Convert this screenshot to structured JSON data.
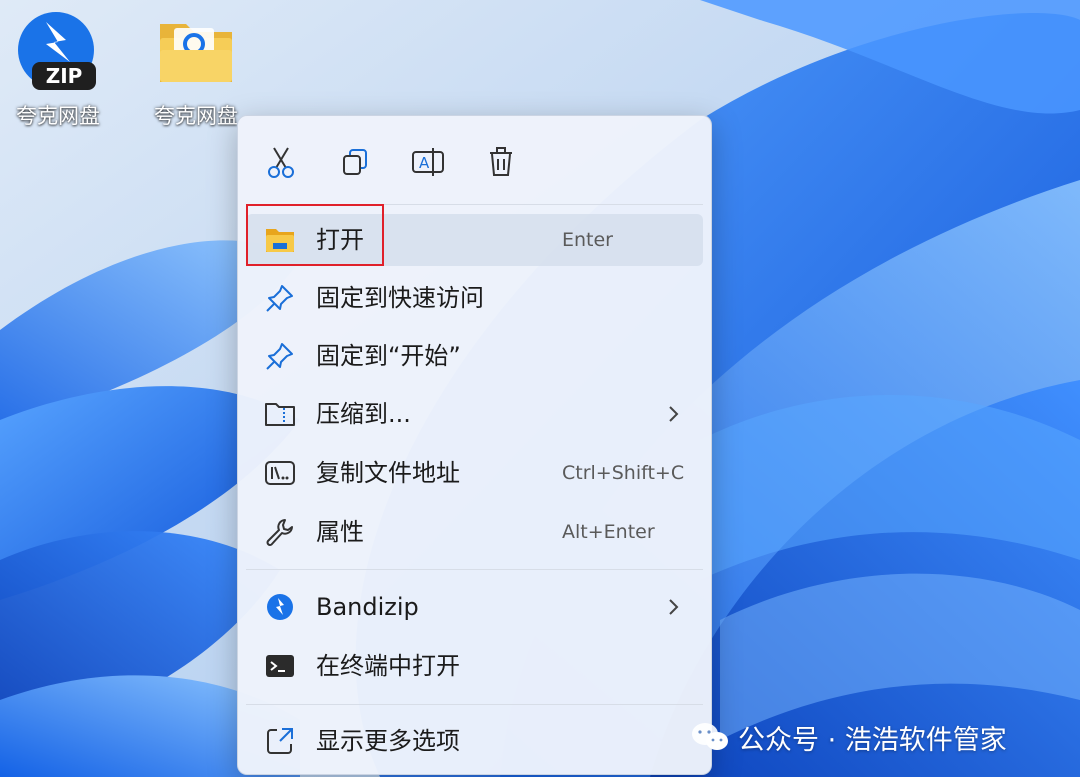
{
  "desktop": {
    "icons": [
      {
        "label": "夸克网盘",
        "icon": "zip-archive-icon",
        "badge": "ZIP"
      },
      {
        "label": "夸克网盘",
        "icon": "folder-icon"
      }
    ]
  },
  "context_menu": {
    "toolbar": [
      {
        "name": "cut",
        "icon": "scissors-icon"
      },
      {
        "name": "copy",
        "icon": "copy-icon"
      },
      {
        "name": "rename",
        "icon": "rename-icon"
      },
      {
        "name": "delete",
        "icon": "trash-icon"
      }
    ],
    "items": [
      {
        "label": "打开",
        "shortcut": "Enter",
        "icon": "folder-open-icon",
        "highlighted": true
      },
      {
        "label": "固定到快速访问",
        "icon": "pin-icon"
      },
      {
        "label": "固定到“开始”",
        "icon": "pin-icon"
      },
      {
        "label": "压缩到...",
        "icon": "zip-folder-icon",
        "submenu": true
      },
      {
        "label": "复制文件地址",
        "shortcut": "Ctrl+Shift+C",
        "icon": "path-icon"
      },
      {
        "label": "属性",
        "shortcut": "Alt+Enter",
        "icon": "wrench-icon"
      },
      {
        "label": "Bandizip",
        "icon": "bandizip-icon",
        "submenu": true
      },
      {
        "label": "在终端中打开",
        "icon": "terminal-icon"
      },
      {
        "label": "显示更多选项",
        "icon": "more-options-icon"
      }
    ]
  },
  "watermark": {
    "text": "公众号 · 浩浩软件管家",
    "icon": "wechat-icon"
  },
  "colors": {
    "highlight_border": "#e0202a",
    "menu_background": "#eef3fb",
    "wallpaper_blue": "#1f6fe0",
    "bandizip_blue": "#1a73e8"
  }
}
